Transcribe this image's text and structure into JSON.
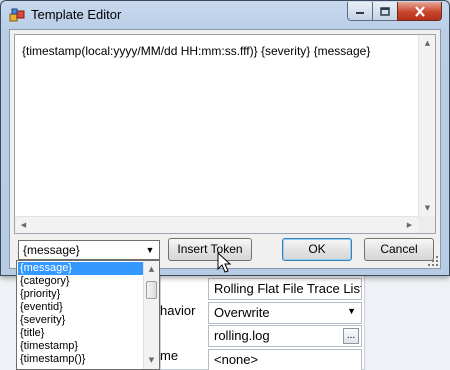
{
  "window": {
    "title": "Template Editor",
    "icon": "app-icon",
    "controls": [
      "minimize-icon",
      "maximize-icon",
      "close-icon"
    ]
  },
  "editor": {
    "text": "{timestamp(local:yyyy/MM/dd HH:mm:ss.fff)} {severity} {message}"
  },
  "token_combo": {
    "value": "{message}"
  },
  "buttons": {
    "insert_token": "Insert Token",
    "ok": "OK",
    "cancel": "Cancel"
  },
  "dropdown": {
    "items": [
      {
        "label": "{message}",
        "selected": true
      },
      {
        "label": "{category}"
      },
      {
        "label": "{priority}"
      },
      {
        "label": "{eventid}"
      },
      {
        "label": "{severity}"
      },
      {
        "label": "{title}"
      },
      {
        "label": "{timestamp}"
      },
      {
        "label": "{timestamp()}"
      }
    ]
  },
  "background_form": {
    "trace_listener": "Rolling Flat File Trace List",
    "behavior_label": "havior",
    "behavior_value": "Overwrite",
    "filename": "rolling.log",
    "name_label": "me",
    "next_value": "<none>"
  },
  "colors": {
    "selection": "#3399ff",
    "title_bar": "#b9cde6",
    "close_button": "#c9452c"
  }
}
